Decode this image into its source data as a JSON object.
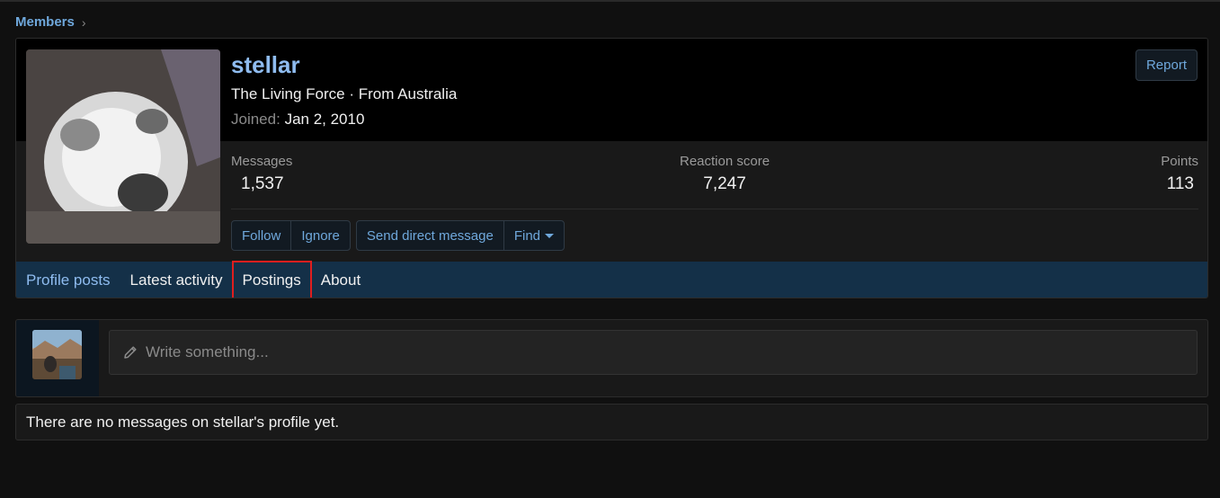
{
  "breadcrumb": {
    "members": "Members"
  },
  "profile": {
    "username": "stellar",
    "subtitle": "The Living Force · From Australia",
    "joined_label": "Joined:",
    "joined_value": "Jan 2, 2010",
    "report_label": "Report"
  },
  "stats": {
    "messages_label": "Messages",
    "messages_value": "1,537",
    "reaction_label": "Reaction score",
    "reaction_value": "7,247",
    "points_label": "Points",
    "points_value": "113"
  },
  "actions": {
    "follow": "Follow",
    "ignore": "Ignore",
    "send_message": "Send direct message",
    "find": "Find"
  },
  "tabs": [
    {
      "label": "Profile posts"
    },
    {
      "label": "Latest activity"
    },
    {
      "label": "Postings"
    },
    {
      "label": "About"
    }
  ],
  "composer": {
    "placeholder": "Write something..."
  },
  "empty_message": "There are no messages on stellar's profile yet.",
  "colors": {
    "accent": "#6fa8dc",
    "tab_bar": "#143048",
    "highlight": "#e01e1e"
  },
  "icons": {
    "pencil": "pencil-icon",
    "caret": "caret-down-icon",
    "chevron": "chevron-right-icon"
  }
}
